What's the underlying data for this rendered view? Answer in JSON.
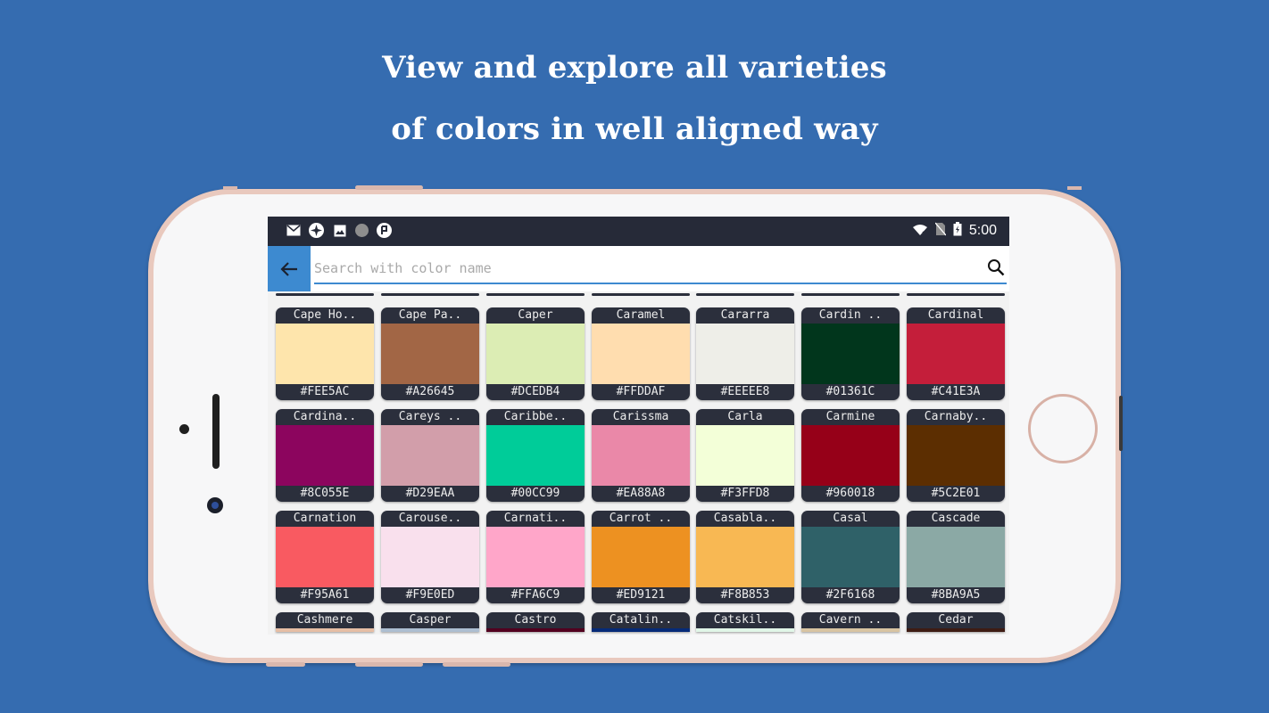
{
  "headline": {
    "line1": "View and explore all varieties",
    "line2": "of colors in well aligned way"
  },
  "status_bar": {
    "time": "5:00",
    "left_icons": [
      "gmail-icon",
      "pinwheel-icon",
      "image-icon",
      "dot-icon",
      "app-icon"
    ],
    "right_icons": [
      "wifi-icon",
      "no-sim-icon",
      "battery-charging-icon"
    ]
  },
  "search": {
    "placeholder": "Search with color name",
    "value": ""
  },
  "colors": [
    {
      "name": "Cape Ho..",
      "hex": "#FEE5AC"
    },
    {
      "name": "Cape Pa..",
      "hex": "#A26645"
    },
    {
      "name": "Caper",
      "hex": "#DCEDB4"
    },
    {
      "name": "Caramel",
      "hex": "#FFDDAF"
    },
    {
      "name": "Cararra",
      "hex": "#EEEEE8"
    },
    {
      "name": "Cardin ..",
      "hex": "#01361C"
    },
    {
      "name": "Cardinal",
      "hex": "#C41E3A"
    },
    {
      "name": "Cardina..",
      "hex": "#8C055E"
    },
    {
      "name": "Careys ..",
      "hex": "#D29EAA"
    },
    {
      "name": "Caribbe..",
      "hex": "#00CC99"
    },
    {
      "name": "Carissma",
      "hex": "#EA88A8"
    },
    {
      "name": "Carla",
      "hex": "#F3FFD8"
    },
    {
      "name": "Carmine",
      "hex": "#960018"
    },
    {
      "name": "Carnaby..",
      "hex": "#5C2E01"
    },
    {
      "name": "Carnation",
      "hex": "#F95A61"
    },
    {
      "name": "Carouse..",
      "hex": "#F9E0ED"
    },
    {
      "name": "Carnati..",
      "hex": "#FFA6C9"
    },
    {
      "name": "Carrot ..",
      "hex": "#ED9121"
    },
    {
      "name": "Casabla..",
      "hex": "#F8B853"
    },
    {
      "name": "Casal",
      "hex": "#2F6168"
    },
    {
      "name": "Cascade",
      "hex": "#8BA9A5"
    }
  ],
  "partial_row": [
    {
      "name": "Cashmere",
      "swatch": "#E6BEA5"
    },
    {
      "name": "Casper",
      "swatch": "#ADBED1"
    },
    {
      "name": "Castro",
      "swatch": "#52001F"
    },
    {
      "name": "Catalin..",
      "swatch": "#062A78"
    },
    {
      "name": "Catskil..",
      "swatch": "#E1F6E8"
    },
    {
      "name": "Cavern ..",
      "swatch": "#D8C4A2"
    },
    {
      "name": "Cedar",
      "swatch": "#3E1C14"
    }
  ],
  "colors_ui": {
    "page_background": "#356cb0",
    "accent": "#3d8ad0",
    "status_bar": "#262a38",
    "tile_frame": "#2b2f3c"
  }
}
